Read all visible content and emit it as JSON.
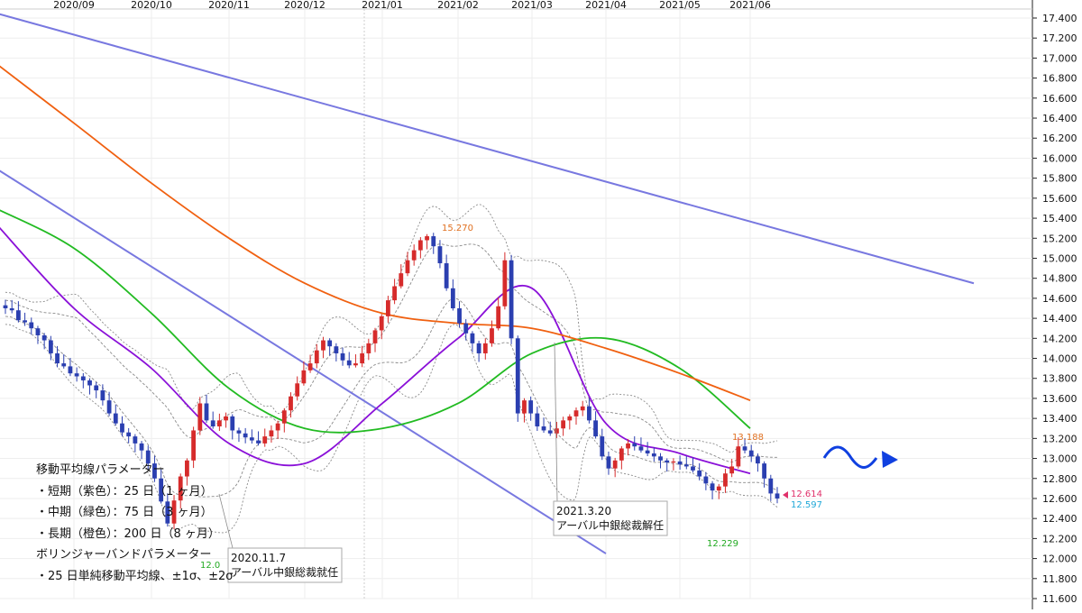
{
  "chart_data": {
    "type": "candlestick",
    "instrument": "",
    "x_ticks": [
      "2020/09",
      "2020/10",
      "2020/11",
      "2020/12",
      "2021/01",
      "2021/02",
      "2021/03",
      "2021/04",
      "2021/05",
      "2021/06"
    ],
    "y_ticks": [
      "17.400",
      "17.200",
      "17.000",
      "16.800",
      "16.600",
      "16.400",
      "16.200",
      "16.000",
      "15.800",
      "15.600",
      "15.400",
      "15.200",
      "15.000",
      "14.800",
      "14.600",
      "14.400",
      "14.200",
      "14.000",
      "13.800",
      "13.600",
      "13.400",
      "13.200",
      "13.000",
      "12.800",
      "12.600",
      "12.400",
      "12.200",
      "12.000",
      "11.800",
      "11.600"
    ],
    "ylim": [
      11.6,
      17.4
    ],
    "grid": true,
    "colors": {
      "up": "#d62b2b",
      "down": "#2b3fb0",
      "ma_short": "#8a10d8",
      "ma_mid": "#22bb22",
      "ma_long": "#f06010",
      "trendline": "#7878e0",
      "bollinger": "#8a8a8a",
      "annotation_green": "#22aa22",
      "annotation_orange": "#e07020",
      "price_pink": "#e0306a",
      "price_cyan": "#20a8d8",
      "arrow": "#1040e0"
    },
    "annotations": {
      "high": "15.270",
      "recent_high": "13.188",
      "low": "12.229",
      "low_clipped": "12.0",
      "price_current": "12.614",
      "price_bid": "12.597"
    },
    "callouts": [
      {
        "date": "2020.11.7",
        "text": "アーバル中銀総裁就任"
      },
      {
        "date": "2021.3.20",
        "text": "アーバル中銀総裁解任"
      }
    ],
    "legend_lines": [
      "移動平均線パラメーター",
      "・短期（紫色）：25 日（1 ヶ月）",
      "・中期（緑色）：75 日（3 ヶ月）",
      "・長期（橙色）：200 日（8 ヶ月）",
      "ボリンジャーバンドパラメーター",
      "・25 日単純移動平均線、±1σ、±2σ"
    ],
    "trendlines": [
      {
        "name": "upper",
        "from": [
          "2020/08",
          17.45
        ],
        "to": [
          "2021/07",
          14.75
        ]
      },
      {
        "name": "lower",
        "from": [
          "2020/08",
          15.9
        ],
        "to": [
          "2021/04",
          12.05
        ]
      }
    ],
    "series": [
      {
        "name": "ma_short",
        "x": [
          "2020/08",
          "2020/09",
          "2020/10",
          "2020/11",
          "2020/12",
          "2021/01",
          "2021/02",
          "2021/03",
          "2021/04",
          "2021/05",
          "2021/06"
        ],
        "values": [
          15.35,
          14.5,
          13.9,
          13.15,
          12.95,
          13.55,
          14.2,
          14.7,
          13.35,
          13.05,
          12.85
        ]
      },
      {
        "name": "ma_mid",
        "x": [
          "2020/08",
          "2020/09",
          "2020/10",
          "2020/11",
          "2020/12",
          "2021/01",
          "2021/02",
          "2021/03",
          "2021/04",
          "2021/05",
          "2021/06"
        ],
        "values": [
          15.5,
          15.1,
          14.45,
          13.7,
          13.3,
          13.3,
          13.55,
          14.05,
          14.2,
          13.9,
          13.3
        ]
      },
      {
        "name": "ma_long",
        "x": [
          "2020/08",
          "2020/09",
          "2020/10",
          "2020/11",
          "2020/12",
          "2021/01",
          "2021/02",
          "2021/03",
          "2021/04",
          "2021/05",
          "2021/06"
        ],
        "values": [
          16.95,
          16.35,
          15.75,
          15.2,
          14.75,
          14.45,
          14.35,
          14.3,
          14.1,
          13.85,
          13.58
        ]
      }
    ],
    "candles": {
      "close": [
        14.5,
        14.48,
        14.38,
        14.36,
        14.3,
        14.23,
        14.18,
        14.05,
        13.95,
        13.92,
        13.85,
        13.82,
        13.78,
        13.73,
        13.68,
        13.58,
        13.45,
        13.35,
        13.26,
        13.22,
        13.15,
        13.08,
        12.95,
        12.8,
        12.57,
        12.35,
        12.58,
        12.82,
        12.98,
        13.28,
        13.55,
        13.38,
        13.32,
        13.38,
        13.42,
        13.28,
        13.25,
        13.21,
        13.18,
        13.15,
        13.22,
        13.28,
        13.35,
        13.48,
        13.62,
        13.75,
        13.88,
        13.95,
        14.08,
        14.18,
        14.12,
        14.05,
        13.98,
        13.93,
        13.95,
        14.05,
        14.15,
        14.28,
        14.42,
        14.58,
        14.72,
        14.85,
        14.98,
        15.08,
        15.18,
        15.22,
        15.12,
        14.95,
        14.7,
        14.5,
        14.35,
        14.25,
        14.15,
        14.05,
        14.15,
        14.3,
        14.52,
        14.98,
        14.2,
        13.45,
        13.58,
        13.45,
        13.32,
        13.28,
        13.25,
        13.3,
        13.38,
        13.42,
        13.48,
        13.52,
        13.38,
        13.22,
        13.02,
        12.9,
        12.98,
        13.1,
        13.15,
        13.12,
        13.08,
        13.05,
        13.02,
        12.98,
        12.96,
        12.97,
        12.94,
        12.92,
        12.88,
        12.82,
        12.75,
        12.68,
        12.72,
        12.85,
        12.92,
        13.12,
        13.08,
        13.02,
        12.95,
        12.8,
        12.65,
        12.6
      ],
      "volatility": 0.07
    }
  }
}
